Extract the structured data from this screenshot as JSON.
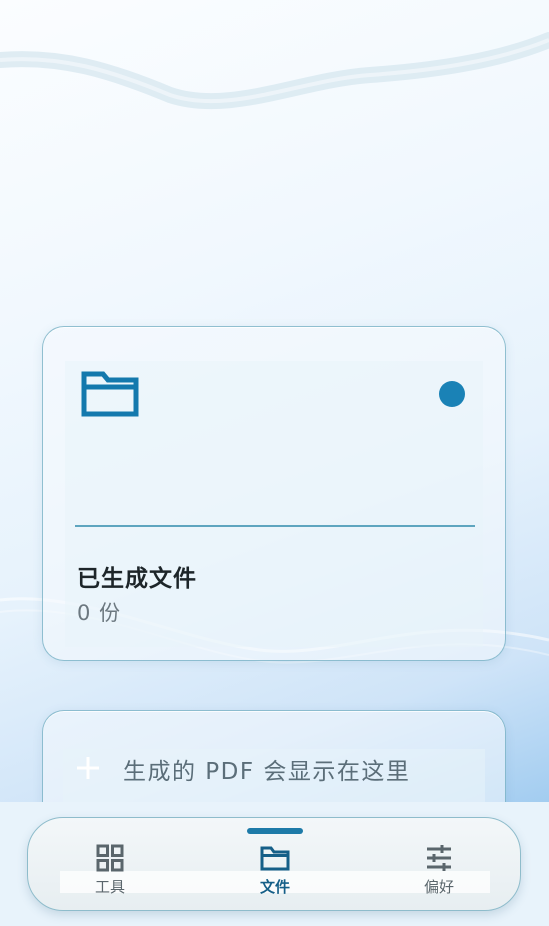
{
  "files_card": {
    "title": "已生成文件",
    "count": "0 份",
    "folder_icon": "folder-icon",
    "status_color": "#1a82b6"
  },
  "hint_card": {
    "icon": "plus-icon",
    "text": "生成的 PDF 会显示在这里"
  },
  "nav": {
    "items": [
      {
        "label": "工具",
        "icon": "grid-icon",
        "active": false
      },
      {
        "label": "文件",
        "icon": "folder-icon",
        "active": true
      },
      {
        "label": "偏好",
        "icon": "sliders-icon",
        "active": false
      }
    ]
  },
  "colors": {
    "accent": "#1d7aa8",
    "active_label": "#155f88",
    "inactive_label": "#5a666c"
  }
}
